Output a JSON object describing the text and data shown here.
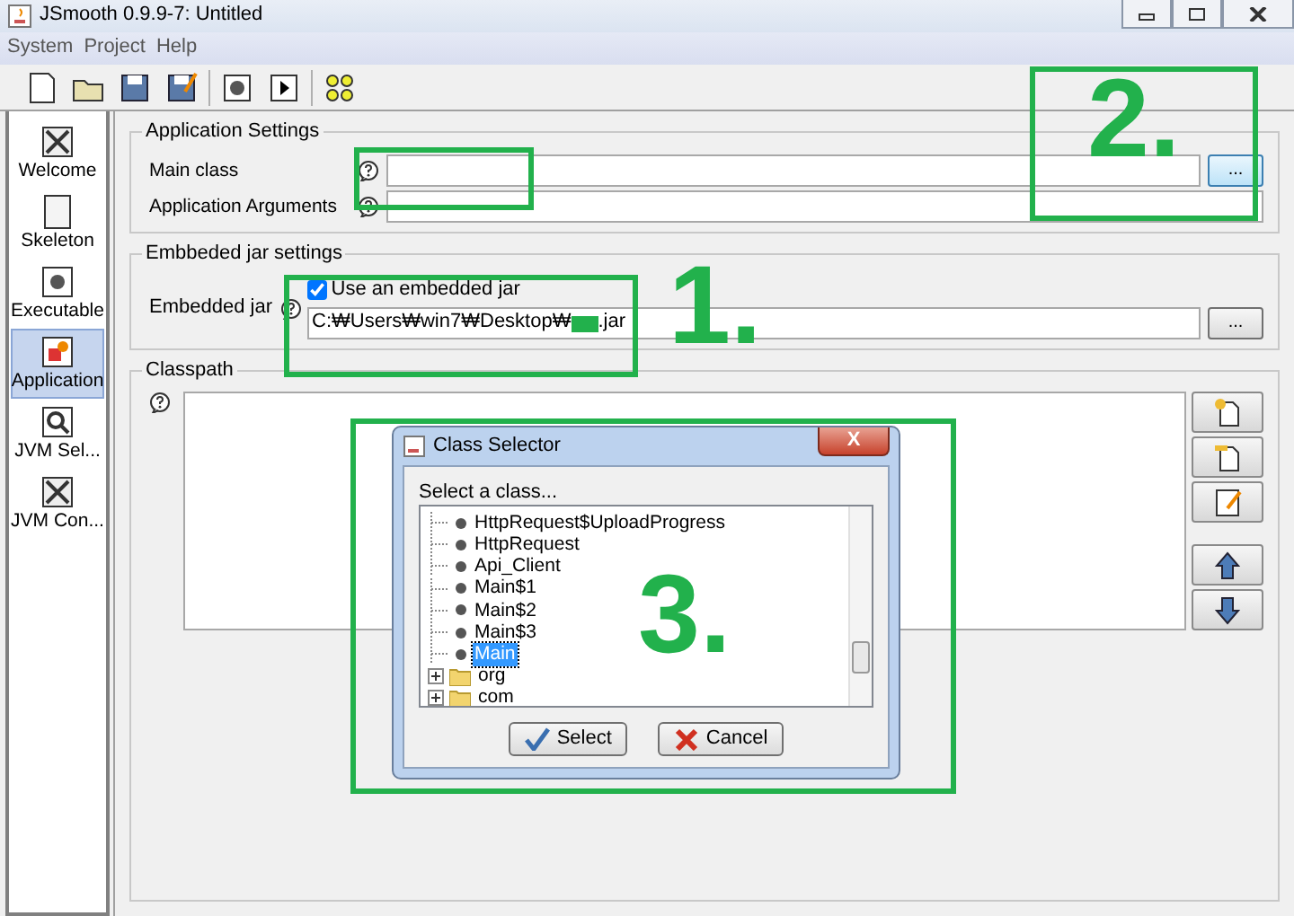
{
  "window": {
    "title": "JSmooth 0.9.9-7: Untitled"
  },
  "menu": [
    "System",
    "Project",
    "Help"
  ],
  "sidebar": {
    "items": [
      {
        "label": "Welcome",
        "selected": false
      },
      {
        "label": "Skeleton",
        "selected": false
      },
      {
        "label": "Executable",
        "selected": false
      },
      {
        "label": "Application",
        "selected": true
      },
      {
        "label": "JVM Sel...",
        "selected": false
      },
      {
        "label": "JVM Con...",
        "selected": false
      }
    ]
  },
  "application_settings": {
    "title": "Application Settings",
    "main_class_label": "Main class",
    "arguments_label": "Application Arguments",
    "browse_button": "..."
  },
  "embedded_jar_settings": {
    "title": "Embbeded jar settings",
    "label": "Embedded jar",
    "checkbox_label": "Use an embedded jar",
    "checked": true,
    "path_start": "C:₩Users₩win7₩Desktop₩",
    "path_end": ".jar",
    "browse_button": "..."
  },
  "classpath": {
    "title": "Classpath"
  },
  "dialog": {
    "title": "Class Selector",
    "prompt": "Select a class...",
    "close": "X",
    "tree": [
      {
        "kind": "class",
        "label": "HttpRequest$UploadProgress",
        "selected": false
      },
      {
        "kind": "class",
        "label": "HttpRequest",
        "selected": false
      },
      {
        "kind": "class",
        "label": "Api_Client",
        "selected": false
      },
      {
        "kind": "class",
        "label": "Main$1",
        "selected": false
      },
      {
        "kind": "class",
        "label": "Main$2",
        "selected": false
      },
      {
        "kind": "class",
        "label": "Main$3",
        "selected": false
      },
      {
        "kind": "class",
        "label": "Main",
        "selected": true
      },
      {
        "kind": "package",
        "label": "org",
        "selected": false
      },
      {
        "kind": "package",
        "label": "com",
        "selected": false
      }
    ],
    "buttons": [
      "Select",
      "Cancel"
    ]
  },
  "annotations": [
    {
      "kind": "outline"
    },
    {
      "kind": "numbered",
      "label": "1."
    },
    {
      "kind": "numbered",
      "label": "2."
    },
    {
      "kind": "numbered",
      "label": "3."
    }
  ]
}
